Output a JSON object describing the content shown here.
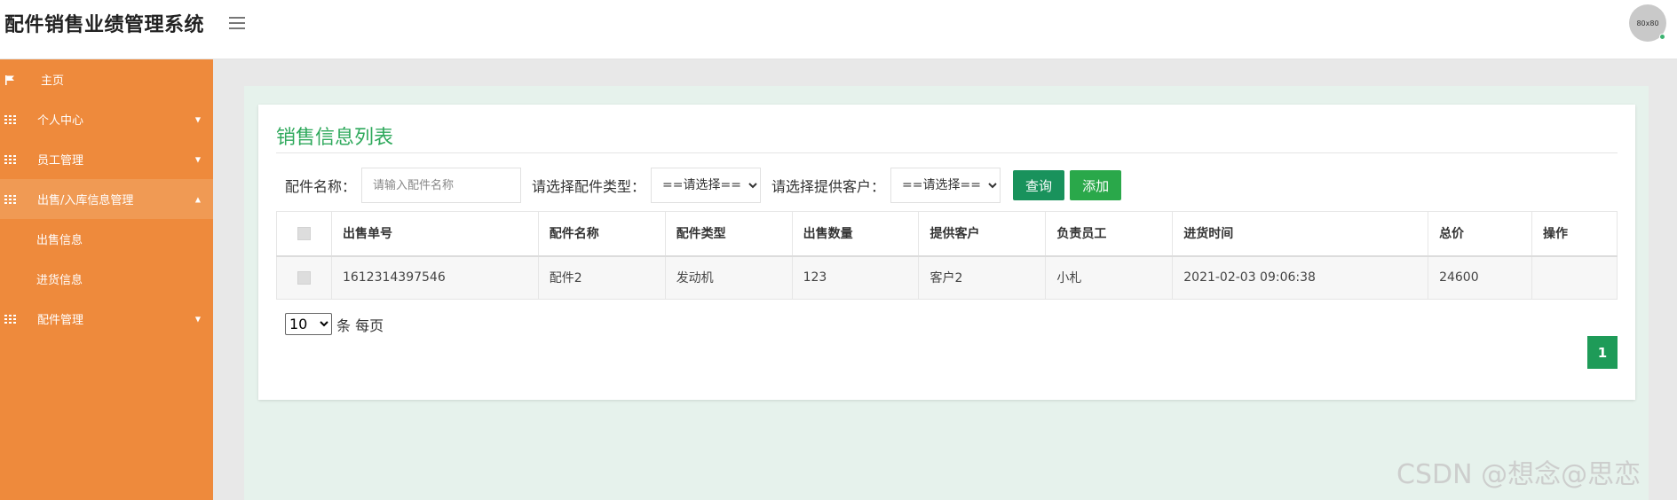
{
  "header": {
    "app_title": "配件销售业绩管理系统",
    "avatar_text": "80x80"
  },
  "sidebar": {
    "items": [
      {
        "label": "主页",
        "icon": "flag-icon"
      },
      {
        "label": "个人中心",
        "icon": "grid-icon"
      },
      {
        "label": "员工管理",
        "icon": "grid-icon"
      },
      {
        "label": "出售/入库信息管理",
        "icon": "grid-icon",
        "children": [
          {
            "label": "出售信息"
          },
          {
            "label": "进货信息"
          }
        ]
      },
      {
        "label": "配件管理",
        "icon": "grid-icon"
      }
    ]
  },
  "main": {
    "card_title": "销售信息列表",
    "filters": {
      "name_label": "配件名称：",
      "name_placeholder": "请输入配件名称",
      "type_label": "请选择配件类型：",
      "type_selected": "==请选择==",
      "customer_label": "请选择提供客户：",
      "customer_selected": "==请选择==",
      "query_label": "查询",
      "add_label": "添加"
    },
    "table": {
      "headers": [
        "出售单号",
        "配件名称",
        "配件类型",
        "出售数量",
        "提供客户",
        "负责员工",
        "进货时间",
        "总价",
        "操作"
      ],
      "rows": [
        [
          "1612314397546",
          "配件2",
          "发动机",
          "123",
          "客户2",
          "小札",
          "2021-02-03 09:06:38",
          "24600",
          ""
        ]
      ]
    },
    "pagination": {
      "page_size": "10",
      "page_size_suffix": "条 每页",
      "current_page": "1"
    }
  },
  "watermark": "CSDN @想念@思恋",
  "colors": {
    "sidebar": "#ee8a3c",
    "title_green": "#2fa95c",
    "query_button": "#19925c",
    "add_button": "#2aa84a",
    "page_button": "#1e9b58"
  }
}
